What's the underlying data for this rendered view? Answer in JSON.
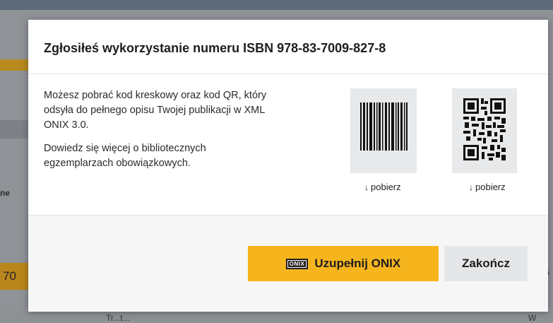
{
  "background": {
    "left_text": "ne",
    "left_number": "70",
    "right_char": "s",
    "bottom_text": "Tr...t...",
    "bottom_right": "W"
  },
  "modal": {
    "title": "Zgłosiłeś wykorzystanie numeru ISBN 978-83-7009-827-8",
    "paragraph1": "Możesz pobrać kod kreskowy oraz kod QR, który odsyła do pełnego opisu Twojej publikacji w XML ONIX 3.0.",
    "paragraph2": "Dowiedz się więcej o bibliotecznych egzemplarzach obowiązkowych.",
    "barcode_download": "pobierz",
    "qr_download": "pobierz",
    "onix_badge": "ONIX",
    "onix_button": "Uzupełnij ONIX",
    "close_button": "Zakończ"
  },
  "colors": {
    "accent": "#f7b51d",
    "secondary_button": "#e4e6e8",
    "card_bg": "#e8e9eb"
  },
  "icons": {
    "barcode": "barcode-icon",
    "qr": "qr-code-icon",
    "download": "arrow-down-icon"
  }
}
